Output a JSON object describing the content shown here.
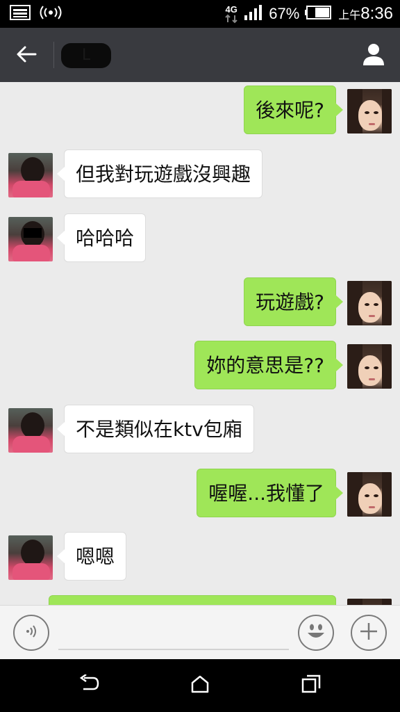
{
  "status_bar": {
    "network": "4G",
    "battery": "67%",
    "time_prefix": "上午",
    "time": "8:36",
    "icons": [
      "image-icon",
      "broadcast-icon",
      "4g-icon",
      "signal-icon",
      "battery-icon"
    ]
  },
  "header": {
    "title": "L"
  },
  "messages": [
    {
      "side": "out",
      "text": "後來呢?"
    },
    {
      "side": "in",
      "text": "但我對玩遊戲沒興趣"
    },
    {
      "side": "in",
      "text": "哈哈哈"
    },
    {
      "side": "out",
      "text": "玩遊戲?"
    },
    {
      "side": "out",
      "text": "妳的意思是??"
    },
    {
      "side": "in",
      "text": "不是類似在ktv包廂"
    },
    {
      "side": "out",
      "text": "喔喔...我懂了"
    },
    {
      "side": "in",
      "text": "嗯嗯"
    },
    {
      "side": "out",
      "text": ""
    }
  ],
  "input_bar": {
    "value": "",
    "icons": [
      "voice-icon",
      "emoji-icon",
      "plus-icon"
    ]
  },
  "nav_bar": {
    "icons": [
      "back-nav-icon",
      "home-icon",
      "recents-icon"
    ]
  },
  "colors": {
    "outgoing_bubble": "#9fe658",
    "incoming_bubble": "#ffffff",
    "header_bg": "#393a3f",
    "chat_bg": "#ebebeb"
  }
}
